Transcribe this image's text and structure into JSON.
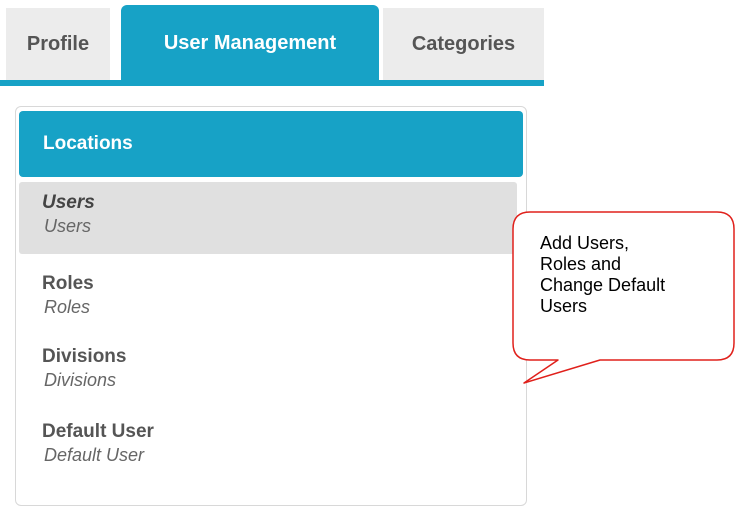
{
  "tabs": {
    "profile": "Profile",
    "user_management": "User Management",
    "categories": "Categories"
  },
  "sidebar": {
    "header": "Locations",
    "items": [
      {
        "title": "Users",
        "subtitle": "Users"
      },
      {
        "title": "Roles",
        "subtitle": "Roles"
      },
      {
        "title": "Divisions",
        "subtitle": "Divisions"
      },
      {
        "title": "Default User",
        "subtitle": "Default User"
      }
    ]
  },
  "callout": {
    "lines": [
      "Add Users,",
      "Roles and",
      "Change Default",
      "Users"
    ]
  },
  "colors": {
    "accent": "#17a2c6",
    "callout_border": "#e0201b"
  }
}
